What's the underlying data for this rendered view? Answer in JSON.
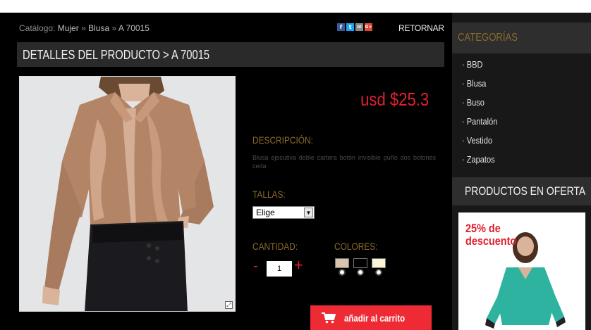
{
  "breadcrumb": {
    "prefix": "Catálogo:",
    "items": [
      "Mujer",
      "»",
      "Blusa",
      "»",
      "A 70015"
    ]
  },
  "share": {
    "icons": [
      "facebook-icon",
      "twitter-icon",
      "email-icon",
      "googleplus-icon"
    ],
    "facebook_glyph": "f",
    "twitter_glyph": "t",
    "email_glyph": "✉",
    "gplus_glyph": "G+"
  },
  "nav": {
    "back_label": "RETORNAR"
  },
  "details": {
    "title": "DETALLES DEL PRODUCTO > A 70015"
  },
  "product": {
    "price": "usd $25.3",
    "description_label": "DESCRIPCIÓN:",
    "description": "Blusa ejecutiva doble cartera botón invisible puño dos botones ceda",
    "sizes_label": "TALLAS:",
    "size_selected": "Elige",
    "quantity_label": "CANTIDAD:",
    "quantity": "1",
    "minus": "-",
    "plus": "+",
    "colors_label": "COLORES:",
    "colors": [
      "#d8c3ab",
      "#000000",
      "#fbf5d6"
    ],
    "add_to_cart": "añadir al carrito"
  },
  "sidebar": {
    "categories_title": "CATEGORÍAS",
    "categories": [
      "· BBD",
      "· Blusa",
      "· Buso",
      "· Pantalón",
      "· Vestido",
      "· Zapatos"
    ],
    "offers_title": "PRODUCTOS EN OFERTA",
    "offer_text_line1": "25% de",
    "offer_text_line2": "descuento"
  },
  "colors": {
    "accent_red": "#e0202e",
    "gold_label": "#8c6b2a",
    "button_red": "#ee2a34"
  }
}
